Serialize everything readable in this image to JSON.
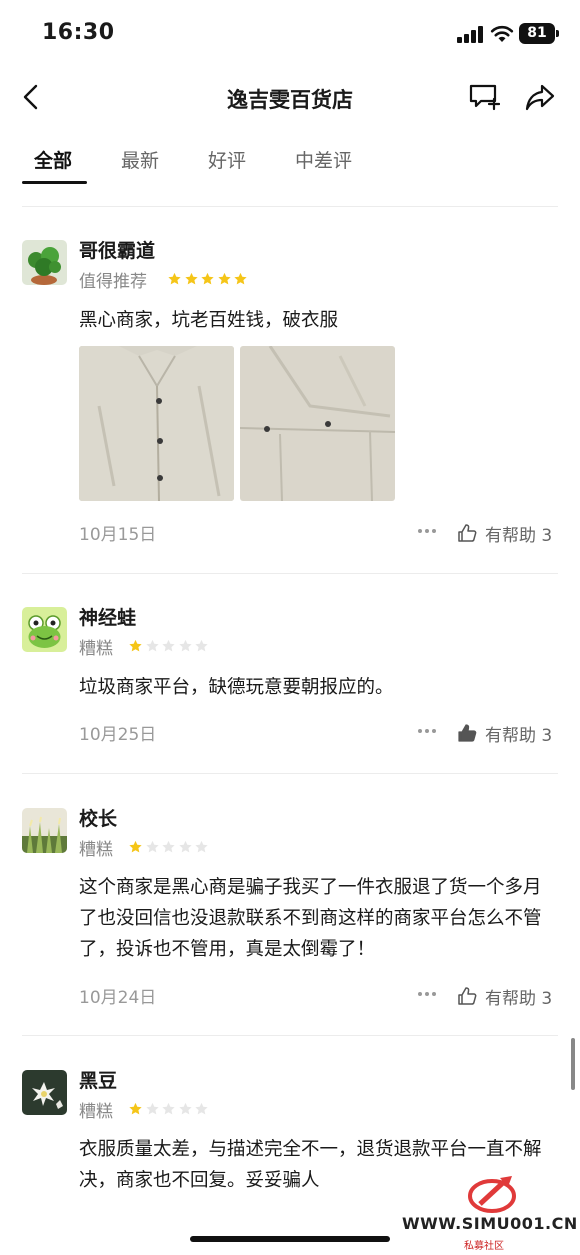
{
  "status": {
    "time": "16:30",
    "battery": "81"
  },
  "nav": {
    "title": "逸吉雯百货店"
  },
  "tabs": [
    {
      "label": "全部",
      "active": true
    },
    {
      "label": "最新",
      "active": false
    },
    {
      "label": "好评",
      "active": false
    },
    {
      "label": "中差评",
      "active": false
    }
  ],
  "reviews": [
    {
      "user": "哥很霸道",
      "rating_label": "值得推荐",
      "stars": 5,
      "text": "黑心商家，坑老百姓钱，破衣服",
      "date": "10月15日",
      "helpful": "有帮助 3",
      "photos": 2
    },
    {
      "user": "神经蛙",
      "rating_label": "糟糕",
      "stars": 1,
      "text": "垃圾商家平台，缺德玩意要朝报应的。",
      "date": "10月25日",
      "helpful": "有帮助 3",
      "photos": 0
    },
    {
      "user": "校长",
      "rating_label": "糟糕",
      "stars": 1,
      "text": "这个商家是黑心商是骗子我买了一件衣服退了货一个多月了也没回信也没退款联系不到商这样的商家平台怎么不管了，投诉也不管用，真是太倒霉了！",
      "date": "10月24日",
      "helpful": "有帮助 3",
      "photos": 0
    },
    {
      "user": "黑豆",
      "rating_label": "糟糕",
      "stars": 1,
      "text": "衣服质量太差，与描述完全不一，退货退款平台一直不解决，商家也不回复。妥妥骗人",
      "date": "",
      "helpful": "",
      "photos": 0
    }
  ],
  "watermark": {
    "text": "WWW.SIMU001.CN",
    "sub": "私募社区"
  },
  "colors": {
    "star_on": "#f5c518",
    "star_off": "#e6e6e6",
    "text_primary": "#1a1a1a",
    "text_secondary": "#888888"
  }
}
